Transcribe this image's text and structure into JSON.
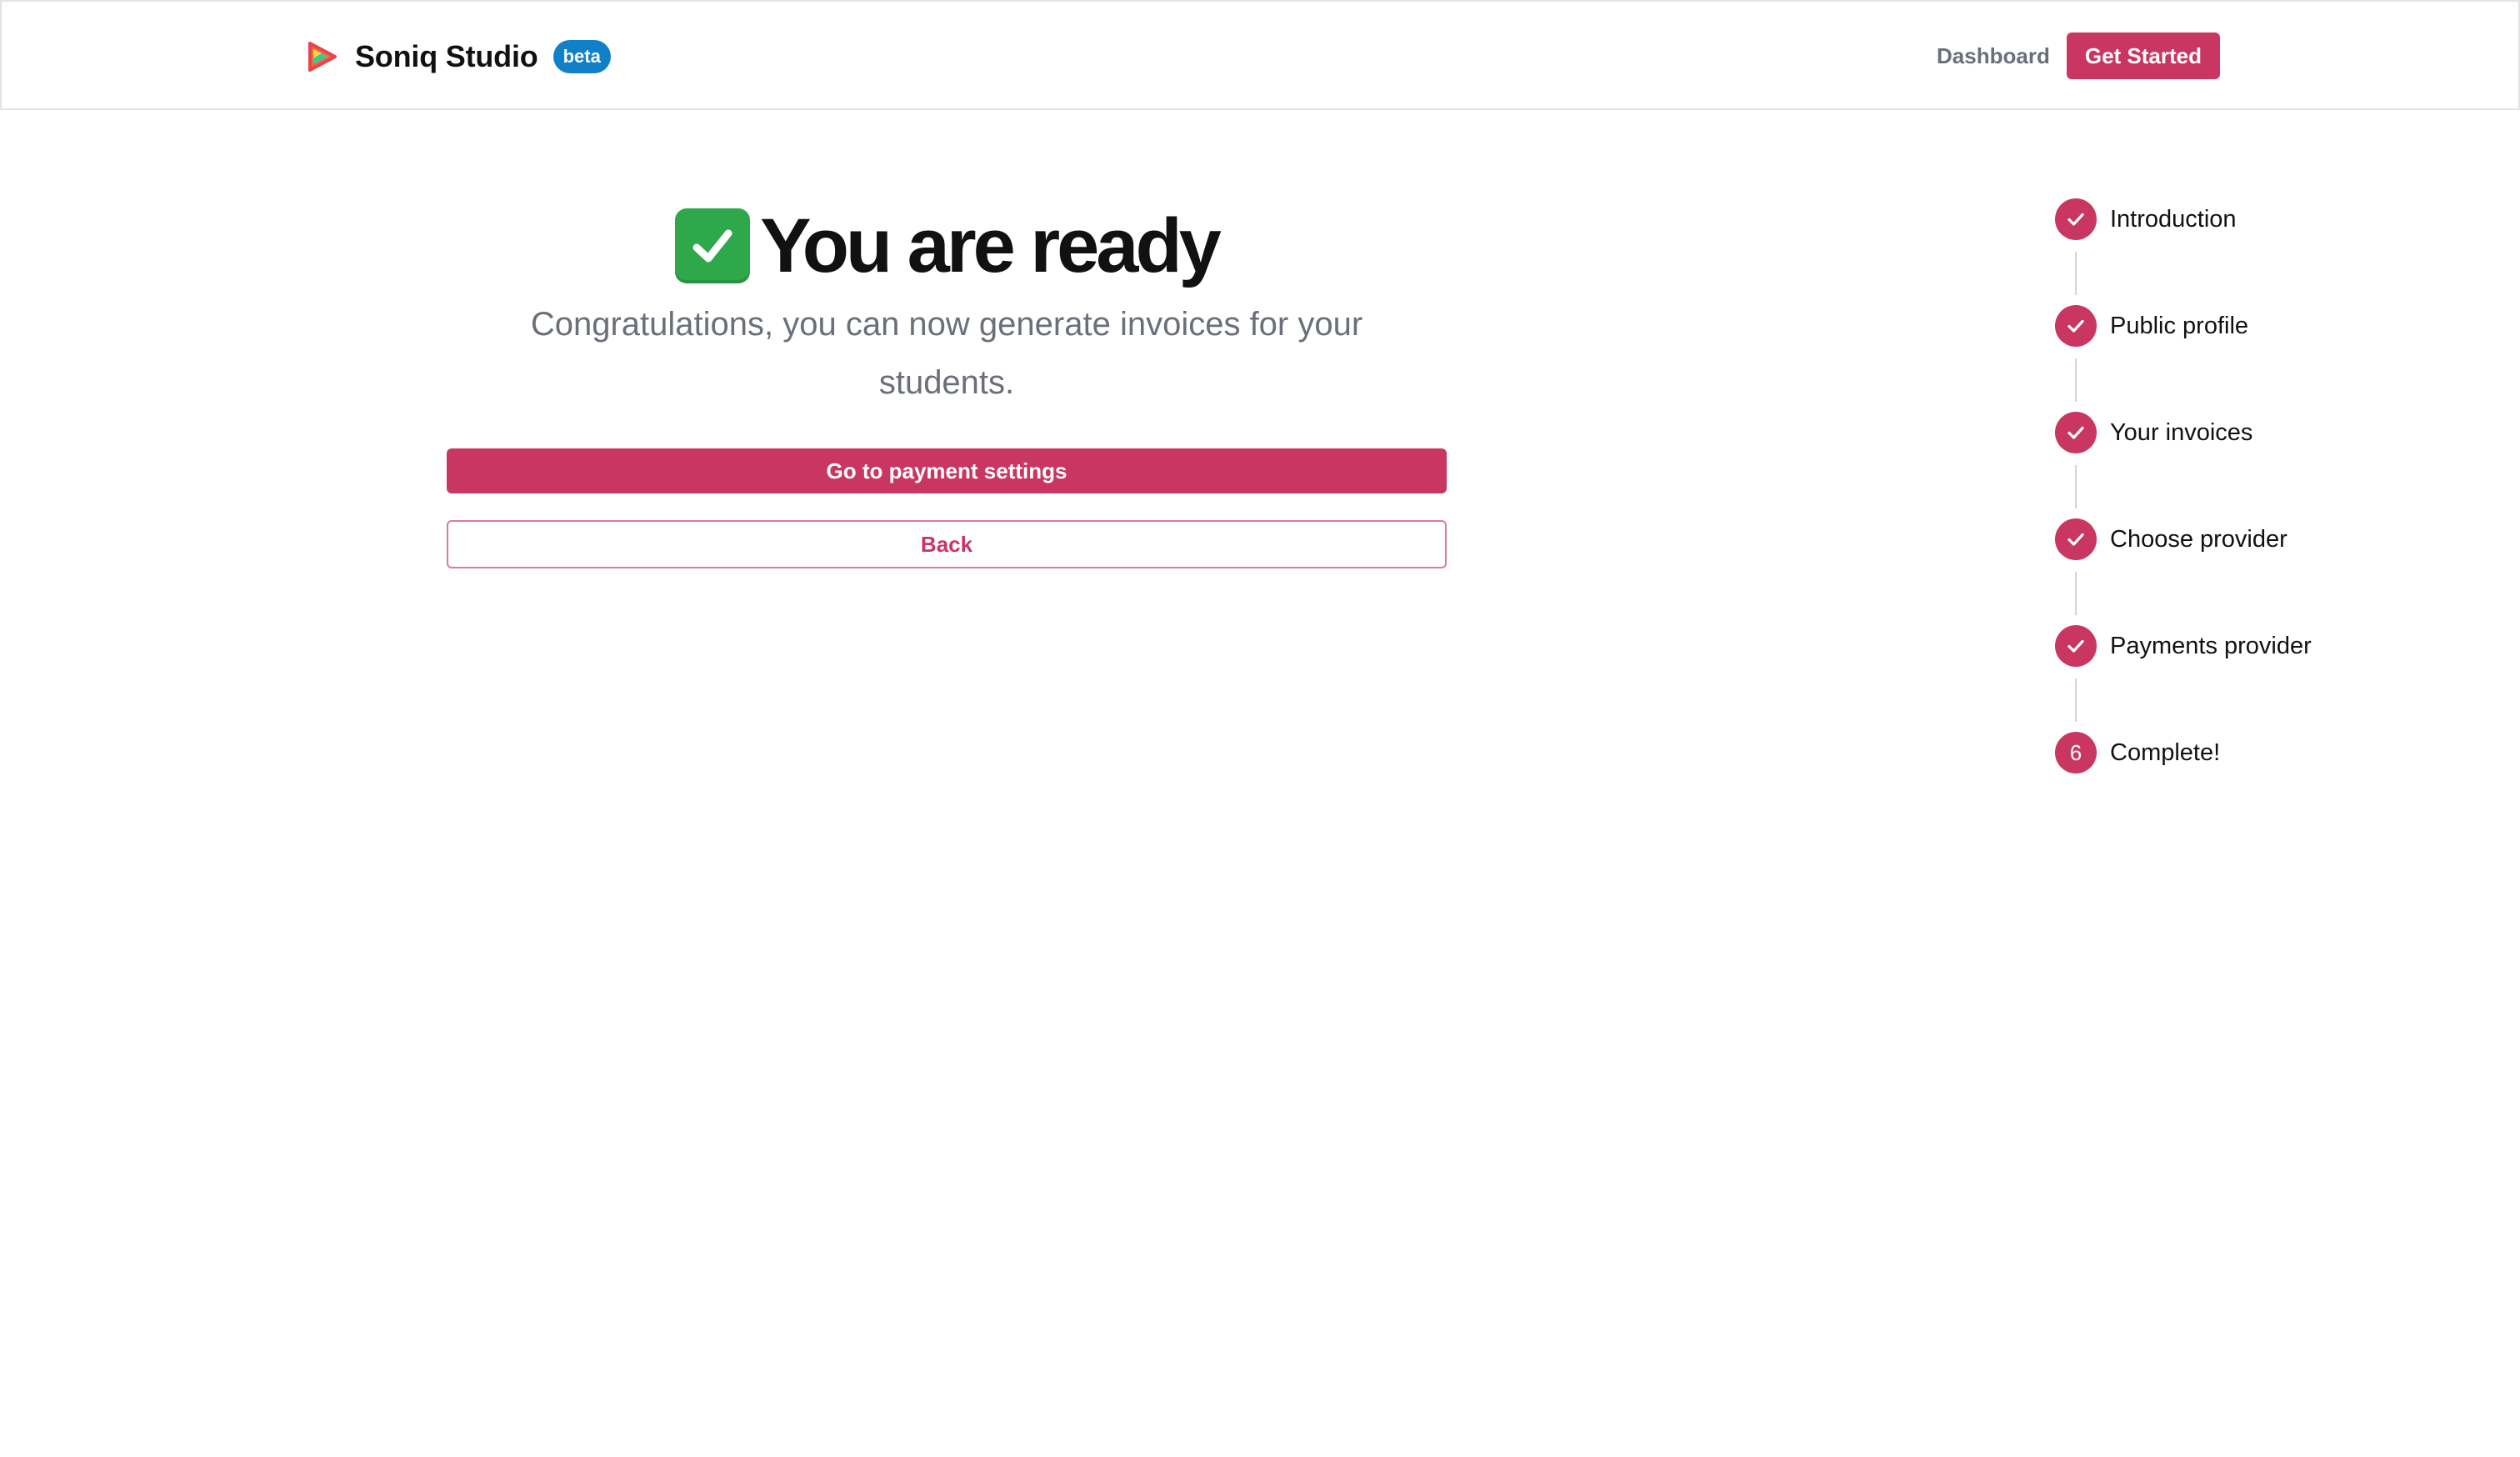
{
  "header": {
    "brand_name": "Soniq Studio",
    "beta_label": "beta",
    "nav_dashboard": "Dashboard",
    "cta_label": "Get Started"
  },
  "main": {
    "emoji_icon": "check-mark-button-emoji",
    "title": "You are ready",
    "subtitle": "Congratulations, you can now generate invoices for your students.",
    "primary_button": "Go to payment settings",
    "secondary_button": "Back"
  },
  "stepper": {
    "steps": [
      {
        "label": "Introduction",
        "status": "complete",
        "icon": "check-icon"
      },
      {
        "label": "Public profile",
        "status": "complete",
        "icon": "check-icon"
      },
      {
        "label": "Your invoices",
        "status": "complete",
        "icon": "check-icon"
      },
      {
        "label": "Choose provider",
        "status": "complete",
        "icon": "check-icon"
      },
      {
        "label": "Payments provider",
        "status": "complete",
        "icon": "check-icon"
      },
      {
        "label": "Complete!",
        "status": "current",
        "number": "6"
      }
    ]
  },
  "colors": {
    "accent": "#c93662",
    "beta_badge": "#1180c9",
    "muted_text": "#6b6f7a",
    "check_emoji": "#2ea84b"
  }
}
